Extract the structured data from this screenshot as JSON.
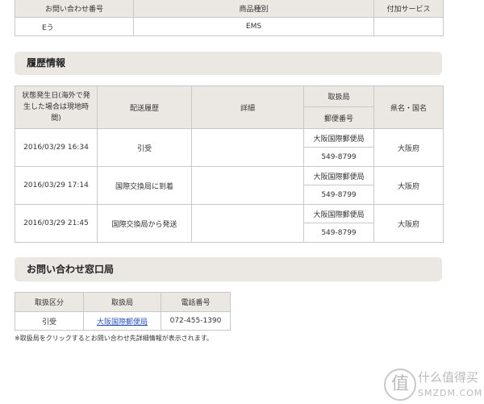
{
  "inquiry_table": {
    "headers": [
      "お問い合わせ番号",
      "商品種別",
      "付加サービス"
    ],
    "row": [
      "Eう",
      "EMS",
      ""
    ]
  },
  "history_section": {
    "title": "履歴情報"
  },
  "history_table": {
    "headers": {
      "date": "状態発生日(海外で発生した場合は現地時間)",
      "status": "配送履歴",
      "detail": "詳細",
      "office": "取扱局",
      "postal": "郵便番号",
      "region": "県名・国名"
    },
    "rows": [
      {
        "date": "2016/03/29 16:34",
        "status": "引受",
        "detail": "",
        "office": "大阪国際郵便局",
        "postal": "549-8799",
        "region": "大阪府"
      },
      {
        "date": "2016/03/29 17:14",
        "status": "国際交換局に到着",
        "detail": "",
        "office": "大阪国際郵便局",
        "postal": "549-8799",
        "region": "大阪府"
      },
      {
        "date": "2016/03/29 21:45",
        "status": "国際交換局から発送",
        "detail": "",
        "office": "大阪国際郵便局",
        "postal": "549-8799",
        "region": "大阪府"
      }
    ]
  },
  "contact_section": {
    "title": "お問い合わせ窓口局"
  },
  "contact_table": {
    "headers": [
      "取扱区分",
      "取扱局",
      "電話番号"
    ],
    "row": {
      "type": "引受",
      "office": "大阪国際郵便局",
      "phone": "072-455-1390"
    }
  },
  "note": "※取扱局をクリックするとお問い合わせ先詳細情報が表示されます。",
  "watermark": {
    "glyph": "值",
    "line1": "什么值得买",
    "line2": "SMZDM.COM"
  }
}
